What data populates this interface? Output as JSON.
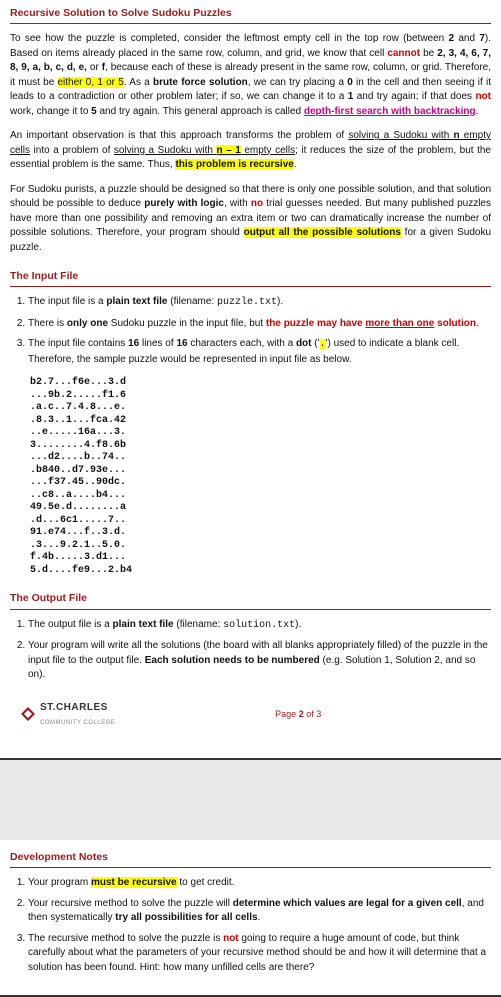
{
  "sections": {
    "recursive_title": "Recursive Solution to Solve Sudoku Puzzles",
    "input_title": "The Input File",
    "output_title": "The Output File",
    "dev_title": "Development Notes"
  },
  "para1": {
    "t1": "To see how the puzzle is completed, consider the leftmost empty cell in the top row (between ",
    "b2": "2",
    "t2": " and ",
    "b7": "7",
    "t3": "). Based on items already placed in the same row, column, and grid, we know that cell ",
    "cannot": "cannot",
    "t4": " be ",
    "vals": "2, 3, 4, 6, 7, 8, 9, a, b, c, d, e,",
    "t5": " or ",
    "f": "f",
    "t6": ", because each of these is already present in the same row, column, or grid. Therefore, it must be ",
    "either": "either 0, 1 or 5",
    "t7": ". As a ",
    "brute": "brute force solution",
    "t8": ", we can try placing a ",
    "b0": "0",
    "t9": " in the cell and then seeing if it leads to a contradiction or other problem later; if so, we can change it to a ",
    "b1": "1",
    "t10": " and try again; if that does ",
    "not": "not",
    "t11": " work, change it to ",
    "b5": "5",
    "t12": " and try again. This general approach is called ",
    "dfs": "depth-first search with backtracking",
    "t13": "."
  },
  "para2": {
    "t1": "An important observation is that this approach transforms the problem of ",
    "u1": "solving a Sudoku with ",
    "n": "n",
    "u2": " empty cells",
    "t2": " into a problem of ",
    "u3": "solving a Sudoku with ",
    "nm1": "n – 1",
    "u4": " empty cells",
    "t3": "; it reduces the size of the problem, but the essential problem is the same. Thus, ",
    "rec": "this problem is recursive",
    "t4": "."
  },
  "para3": {
    "t1": "For Sudoku purists, a puzzle should be designed so that there is only one possible solution, and that solution should be possible to deduce ",
    "logic": "purely with logic",
    "t2": ", with ",
    "no": "no",
    "t3": " trial guesses needed. But many published puzzles have more than one possibility and removing an extra item or two can dramatically increase the number of possible solutions. Therefore, your program should ",
    "out": "output all the possible solutions",
    "t4": " for a given Sudoku puzzle."
  },
  "input_items": {
    "i1a": "The input file is a ",
    "i1b": "plain text file",
    "i1c": " (filename: ",
    "i1file": "puzzle.txt",
    "i1d": ").",
    "i2a": "There is ",
    "i2b": "only one",
    "i2c": " Sudoku puzzle in the input file, but ",
    "i2d": "the puzzle may have ",
    "i2e": "more than one",
    "i2f": " solution",
    "i2g": ".",
    "i3a": "The input file contains ",
    "i3b": "16",
    "i3c": " lines of ",
    "i3d": "16",
    "i3e": " characters each, with a ",
    "i3f": "dot",
    "i3g": " ('",
    "i3dot": ".",
    "i3h": "') used to indicate a blank cell. Therefore, the sample puzzle would be represented in input file as below."
  },
  "chart_data": {
    "type": "table",
    "title": "sample puzzle.txt (16×16 hexadoku grid, '.' = blank)",
    "rows": [
      "b2.7...f6e...3.d",
      "...9b.2.....f1.6",
      ".a.c..7.4.8...e.",
      ".8.3..1...fca.42",
      "..e.....16a...3.",
      "3........4.f8.6b",
      "...d2....b..74..",
      ".b840..d7.93e...",
      "...f37.45..90dc.",
      "..c8..a....b4...",
      "49.5e.d........a",
      ".d...6c1.....7..",
      "91.e74...f..3.d.",
      ".3...9.2.1..5.0.",
      "f.4b.....3.d1...",
      "5.d....fe9...2.b4"
    ]
  },
  "output_items": {
    "o1a": "The output file is a ",
    "o1b": "plain text file",
    "o1c": " (filename: ",
    "o1file": "solution.txt",
    "o1d": ").",
    "o2a": "Your program will write all the solutions (the board with all blanks appropriately filled) of the puzzle in the input file to the output file. ",
    "o2b": "Each solution needs to be numbered",
    "o2c": " (e.g. Solution 1, Solution 2, and so on)."
  },
  "footer": {
    "logo": "ST.CHARLES",
    "logo_sub": "COMMUNITY COLLEGE",
    "page_label_a": "Page ",
    "page_cur": "2",
    "page_label_b": " of ",
    "page_total": "3"
  },
  "dev_items": {
    "d1a": "Your program ",
    "d1b": "must be recursive",
    "d1c": " to get credit.",
    "d2a": "Your recursive method to solve the puzzle will ",
    "d2b": "determine which values are legal for a given cell",
    "d2c": ", and then systematically ",
    "d2d": "try all possibilities for all cells",
    "d2e": ".",
    "d3a": "The recursive method to solve the puzzle is ",
    "d3b": "not",
    "d3c": " going to require a huge amount of code, but think carefully about what the parameters of your recursive method should be and how it will determine that a solution has been found. Hint: how many unfilled cells are there?"
  }
}
